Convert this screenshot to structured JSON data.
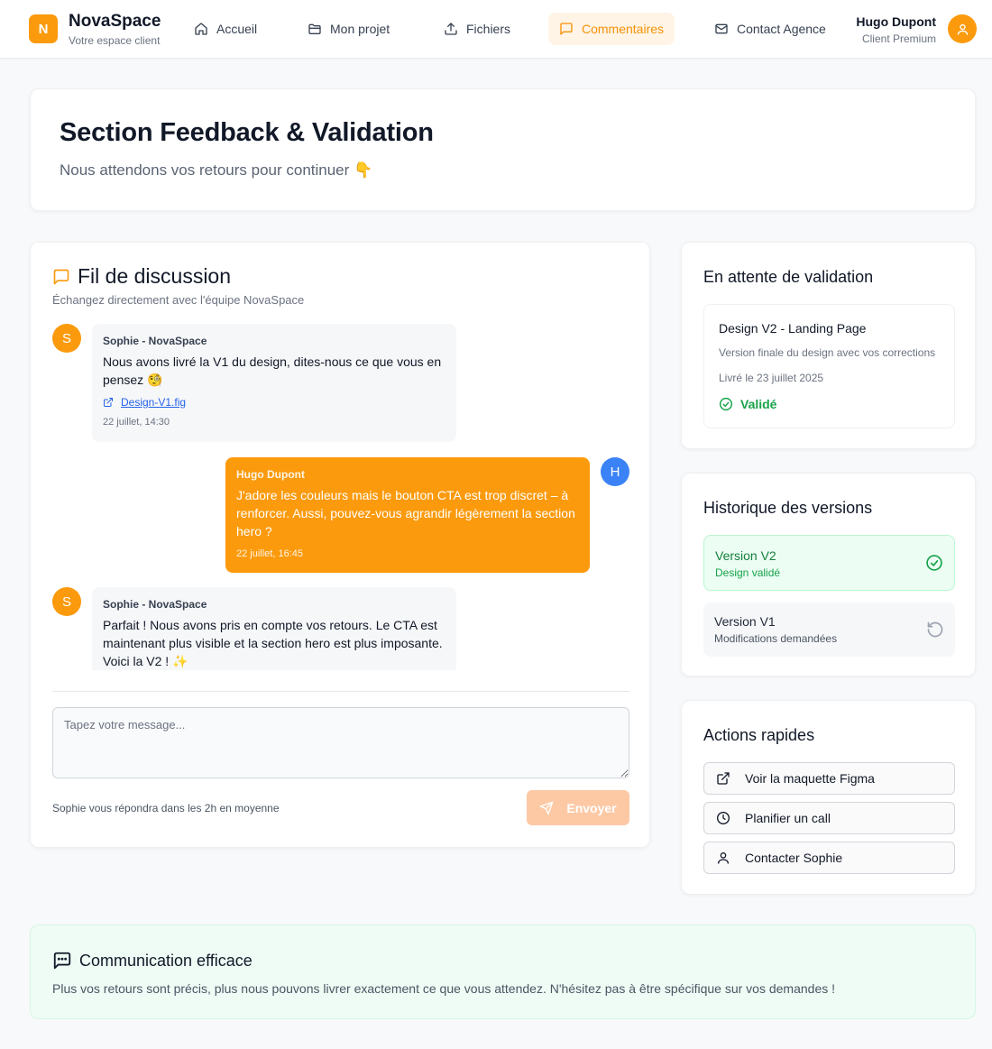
{
  "brand": {
    "logo_letter": "N",
    "name": "NovaSpace",
    "tagline": "Votre espace client"
  },
  "nav": {
    "items": [
      {
        "label": "Accueil",
        "icon": "home-icon"
      },
      {
        "label": "Mon projet",
        "icon": "folder-icon"
      },
      {
        "label": "Fichiers",
        "icon": "upload-icon"
      },
      {
        "label": "Commentaires",
        "icon": "message-square-icon",
        "active": true
      },
      {
        "label": "Contact Agence",
        "icon": "mail-icon"
      }
    ]
  },
  "user": {
    "name": "Hugo Dupont",
    "tier": "Client Premium",
    "avatar_icon": "user-icon"
  },
  "hero": {
    "title": "Section Feedback & Validation",
    "subtitle": "Nous attendons vos retours pour continuer 👇"
  },
  "chat": {
    "title": "Fil de discussion",
    "subtitle": "Échangez directement avec l'équipe NovaSpace",
    "messages": [
      {
        "author": "Sophie - NovaSpace",
        "initial": "S",
        "text": "Nous avons livré la V1 du design, dites-nous ce que vous en pensez 🧐",
        "attachment": "Design-V1.fig",
        "time": "22 juillet, 14:30"
      },
      {
        "author": "Hugo Dupont",
        "initial": "H",
        "text": "J'adore les couleurs mais le bouton CTA est trop discret – à renforcer. Aussi, pouvez-vous agrandir légèrement la section hero ?",
        "time": "22 juillet, 16:45"
      },
      {
        "author": "Sophie - NovaSpace",
        "initial": "S",
        "text": "Parfait ! Nous avons pris en compte vos retours. Le CTA est maintenant plus visible et la section hero est plus imposante. Voici la V2 ! ✨"
      }
    ],
    "input_placeholder": "Tapez votre message...",
    "input_value": "",
    "response_hint": "Sophie vous répondra dans les 2h en moyenne",
    "send_label": "Envoyer"
  },
  "pending": {
    "title": "En attente de validation",
    "item_title": "Design V2 - Landing Page",
    "item_desc": "Version finale du design avec vos corrections",
    "item_date": "Livré le 23 juillet 2025",
    "item_status": "Validé"
  },
  "history": {
    "title": "Historique des versions",
    "versions": [
      {
        "name": "Version V2",
        "status": "Design validé",
        "icon": "check-circle-icon"
      },
      {
        "name": "Version V1",
        "status": "Modifications demandées",
        "icon": "rotate-ccw-icon"
      }
    ]
  },
  "actions": {
    "title": "Actions rapides",
    "buttons": [
      {
        "label": "Voir la maquette Figma",
        "icon": "external-link-icon"
      },
      {
        "label": "Planifier un call",
        "icon": "clock-icon"
      },
      {
        "label": "Contacter Sophie",
        "icon": "user-icon"
      }
    ]
  },
  "tip": {
    "title": "Communication efficace",
    "text": "Plus vos retours sont précis, plus nous pouvons livrer exactement ce que vous attendez. N'hésitez pas à être spécifique sur vos demandes !"
  },
  "colors": {
    "accent": "#fb9a0c",
    "success": "#16a34a",
    "user_avatar": "#3b82f6"
  }
}
